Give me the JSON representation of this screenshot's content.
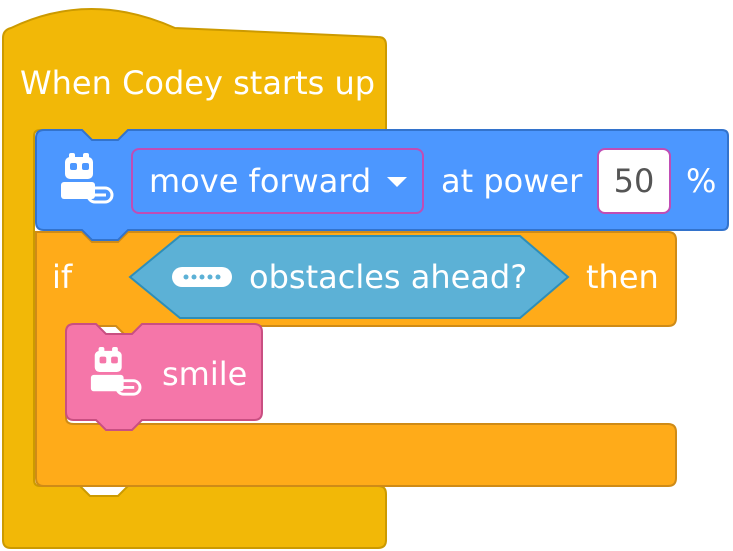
{
  "hat_block": {
    "label": "When Codey starts up"
  },
  "move_block": {
    "direction": "move forward",
    "at_power": "at power",
    "power": "50",
    "unit": "%"
  },
  "if_block": {
    "if_label": "if",
    "condition": "obstacles ahead?",
    "then_label": "then"
  },
  "smile_block": {
    "label": "smile"
  },
  "colors": {
    "event": "#f2b807",
    "motion": "#4c97ff",
    "control": "#ffab19",
    "sensing": "#5cb1d6",
    "looks": "#f576a9"
  },
  "icons": [
    "codey-robot-icon",
    "dropdown-arrow-icon",
    "ultrasonic-sensor-icon"
  ]
}
